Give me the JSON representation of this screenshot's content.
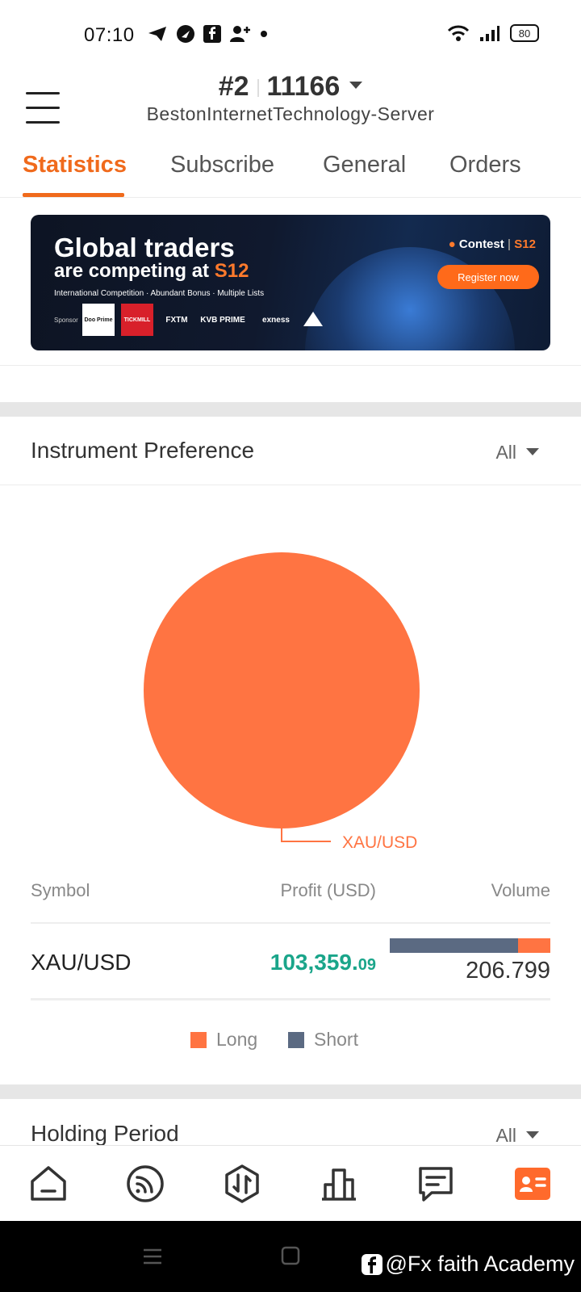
{
  "status_bar": {
    "time": "07:10",
    "battery": "80"
  },
  "header": {
    "account_number": "#2",
    "account_id": "11166",
    "server": "BestonInternetTechnology-Server"
  },
  "tabs": [
    {
      "label": "Statistics",
      "active": true
    },
    {
      "label": "Subscribe",
      "active": false
    },
    {
      "label": "General",
      "active": false
    },
    {
      "label": "Orders",
      "active": false
    }
  ],
  "banner": {
    "headline_1": "Global traders",
    "headline_2": "are competing at ",
    "headline_brand": "S12",
    "subline": "International Competition · Abundant Bonus · Multiple Lists",
    "sponsor_label": "Sponsor",
    "sponsors": [
      "Doo Prime",
      "TICKMILL",
      "FXTM",
      "KVB PRIME",
      "exness"
    ],
    "contest_label": "Contest",
    "contest_brand": "S12",
    "register_label": "Register now"
  },
  "instrument_preference": {
    "title": "Instrument Preference",
    "filter": "All",
    "pie_label": "XAU/USD",
    "columns": {
      "symbol": "Symbol",
      "profit": "Profit (USD)",
      "volume": "Volume"
    },
    "rows": [
      {
        "symbol": "XAU/USD",
        "profit_main": "103,359.",
        "profit_cents": "09",
        "volume": "206.799",
        "short_fraction": 0.8,
        "long_fraction": 0.2
      }
    ],
    "legend": {
      "long": "Long",
      "short": "Short"
    }
  },
  "holding_period": {
    "title": "Holding Period",
    "filter": "All"
  },
  "bottom_nav": [
    "home-icon",
    "feed-icon",
    "trade-icon",
    "ranking-icon",
    "messages-icon",
    "profile-icon"
  ],
  "watermark": "@Fx faith Academy",
  "colors": {
    "accent": "#f06a1c",
    "pie": "#ff7442",
    "profit": "#1aa58a",
    "short": "#5b6a82"
  },
  "chart_data": {
    "type": "pie",
    "categories": [
      "XAU/USD"
    ],
    "values": [
      100
    ]
  }
}
